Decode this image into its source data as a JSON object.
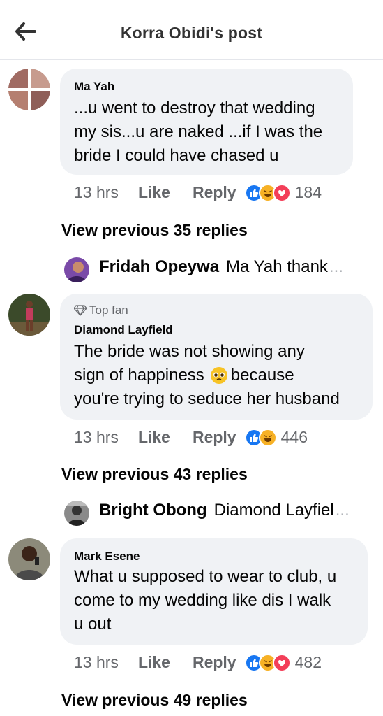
{
  "header": {
    "title": "Korra Obidi's post"
  },
  "comments": [
    {
      "author": "Ma Yah",
      "lines": [
        "...u went to destroy that wedding",
        "my sis...u are naked ...if I was the",
        "bride I could have chased u"
      ],
      "time": "13 hrs",
      "like": "Like",
      "reply": "Reply",
      "reactions": [
        "like",
        "haha",
        "love"
      ],
      "count": "184",
      "view_previous": "View previous 35 replies",
      "reply_preview": {
        "name": "Fridah Opeywa",
        "text": "Ma Yah thank",
        "ellipsis": "..."
      }
    },
    {
      "badge": "Top fan",
      "author": "Diamond Layfield",
      "lines": [
        "The bride was not  showing any",
        "sign of happiness",
        "because",
        "you're trying to seduce her husband"
      ],
      "time": "13 hrs",
      "like": "Like",
      "reply": "Reply",
      "reactions": [
        "like",
        "haha"
      ],
      "count": "446",
      "view_previous": "View previous 43 replies",
      "reply_preview": {
        "name": "Bright Obong",
        "text": "Diamond Layfiel",
        "ellipsis": "..."
      }
    },
    {
      "author": "Mark Esene",
      "lines": [
        "What u supposed to wear to club, u",
        "come to my wedding like dis I walk",
        "u out"
      ],
      "time": "13 hrs",
      "like": "Like",
      "reply": "Reply",
      "reactions": [
        "like",
        "haha",
        "love"
      ],
      "count": "482",
      "view_previous": "View previous 49 replies"
    }
  ],
  "colors": {
    "like": "#1877f2",
    "love": "#f33e58",
    "haha": "#f7b125",
    "bubble": "#f0f2f5",
    "meta": "#65676b"
  }
}
